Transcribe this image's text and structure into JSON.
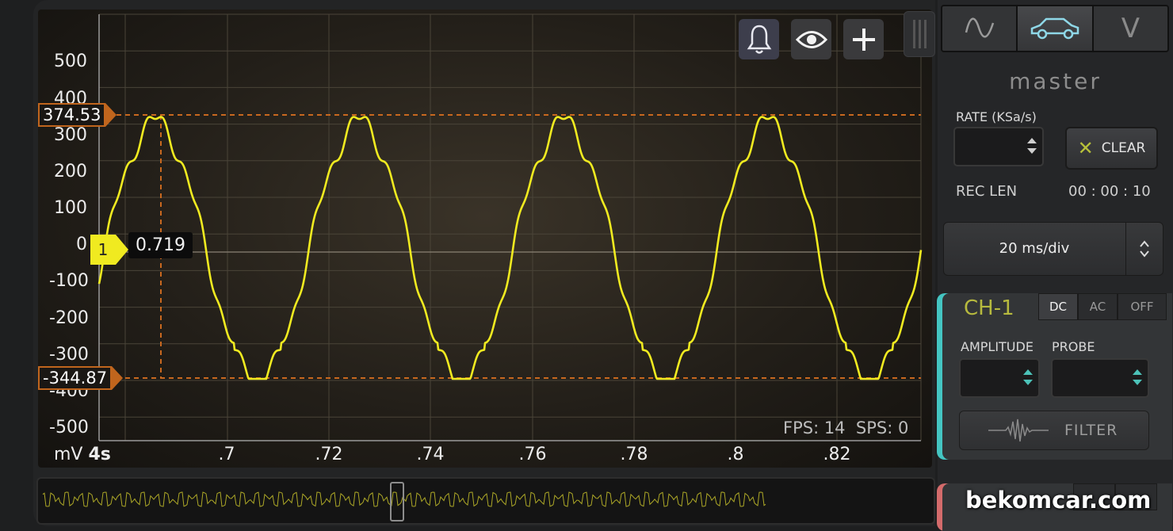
{
  "scope": {
    "y_ticks": [
      "500",
      "400",
      "300",
      "200",
      "100",
      "0",
      "-100",
      "-200",
      "-300",
      "-400",
      "-500"
    ],
    "x_ticks": [
      ".7",
      ".72",
      ".74",
      ".76",
      ".78",
      ".8",
      ".82"
    ],
    "unit": "mV",
    "timebase_badge": "4s",
    "fps_label": "FPS: 14",
    "sps_label": "SPS: 0",
    "cursor_upper": "374.53",
    "cursor_lower": "-344.87",
    "channel_marker": "1",
    "readout_value": "0.719",
    "colors": {
      "trace": "#f0ea20",
      "cursor": "#c8681f",
      "grid": "#4a4438"
    },
    "toolbar_icons": [
      "bell-icon",
      "eye-icon",
      "plus-icon"
    ]
  },
  "panel": {
    "tabs": [
      {
        "icon": "sine-wave-icon"
      },
      {
        "icon": "car-icon",
        "active": true
      },
      {
        "label": "V"
      }
    ],
    "title": "master",
    "rate_label": "RATE (KSa/s)",
    "rate_value": "",
    "clear_label": "CLEAR",
    "rec_len_label": "REC LEN",
    "rec_len_value": "00 : 00 : 10",
    "time_div": "20 ms/div",
    "ch1": {
      "title": "CH-1",
      "coupling": [
        "DC",
        "AC",
        "OFF"
      ],
      "coupling_selected": "DC",
      "amplitude_label": "AMPLITUDE",
      "probe_label": "PROBE",
      "filter_label": "FILTER",
      "color": "#44c5c2"
    },
    "ch2": {
      "color": "#d46b6b"
    },
    "watermark": "bekomcar.com"
  }
}
